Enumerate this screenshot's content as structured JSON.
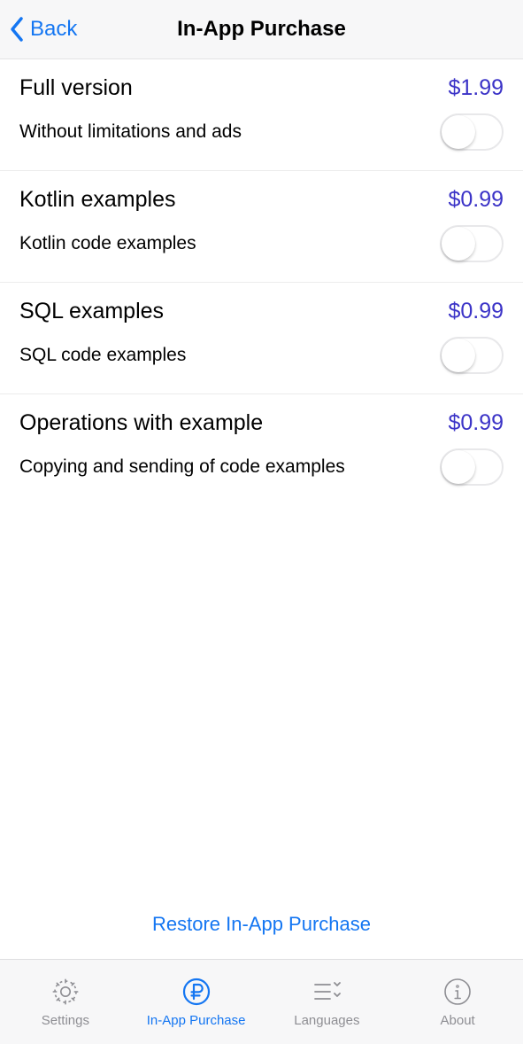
{
  "nav": {
    "back": "Back",
    "title": "In-App Purchase"
  },
  "items": [
    {
      "title": "Full version",
      "price": "$1.99",
      "sub": "Without limitations and ads",
      "on": false
    },
    {
      "title": "Kotlin examples",
      "price": "$0.99",
      "sub": "Kotlin code examples",
      "on": false
    },
    {
      "title": "SQL examples",
      "price": "$0.99",
      "sub": "SQL code examples",
      "on": false
    },
    {
      "title": "Operations with example",
      "price": "$0.99",
      "sub": "Copying and sending of code examples",
      "on": false
    }
  ],
  "restore": "Restore In-App Purchase",
  "tabs": {
    "settings": "Settings",
    "iap": "In-App Purchase",
    "languages": "Languages",
    "about": "About",
    "active": "iap"
  }
}
